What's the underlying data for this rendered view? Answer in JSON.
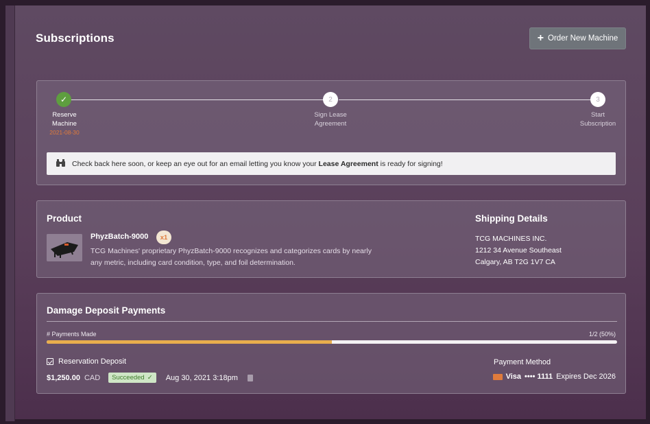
{
  "header": {
    "title": "Subscriptions",
    "order_button_label": "Order New Machine"
  },
  "steps": [
    {
      "number": "",
      "label_line1": "Reserve",
      "label_line2": "Machine",
      "date": "2021-08-30",
      "done": true
    },
    {
      "number": "2",
      "label_line1": "Sign Lease",
      "label_line2": "Agreement",
      "date": "",
      "done": false
    },
    {
      "number": "3",
      "label_line1": "Start",
      "label_line2": "Subscription",
      "date": "",
      "done": false
    }
  ],
  "notice": {
    "text_before": "Check back here soon, or keep an eye out for an email letting you know your ",
    "text_bold": "Lease Agreement",
    "text_after": " is ready for signing!"
  },
  "product": {
    "heading": "Product",
    "name": "PhyzBatch-9000",
    "quantity": "x1",
    "description_line1": "TCG Machines' proprietary PhyzBatch-9000 recognizes and categorizes cards by nearly",
    "description_line2": "any metric, including card condition, type, and foil determination."
  },
  "shipping": {
    "heading": "Shipping Details",
    "line1": "TCG MACHINES INC.",
    "line2": "1212 34 Avenue Southeast",
    "line3": "Calgary, AB T2G 1V7 CA"
  },
  "deposit": {
    "heading": "Damage Deposit Payments",
    "payments_label": "# Payments Made",
    "payments_ratio": "1/2 (50%)",
    "progress_fraction": 0.5,
    "reservation_title": "Reservation Deposit",
    "amount": "$1,250.00",
    "currency": "CAD",
    "status": "Succeeded",
    "date": "Aug 30, 2021 3:18pm",
    "payment_method_heading": "Payment Method",
    "card_brand": "Visa",
    "card_last4": "•••• 1111",
    "card_expiry": "Expires Dec 2026"
  },
  "colors": {
    "accent_orange": "#e07b3c",
    "success_green": "#5e9e3f",
    "progress_yellow": "#e8ae4d"
  }
}
